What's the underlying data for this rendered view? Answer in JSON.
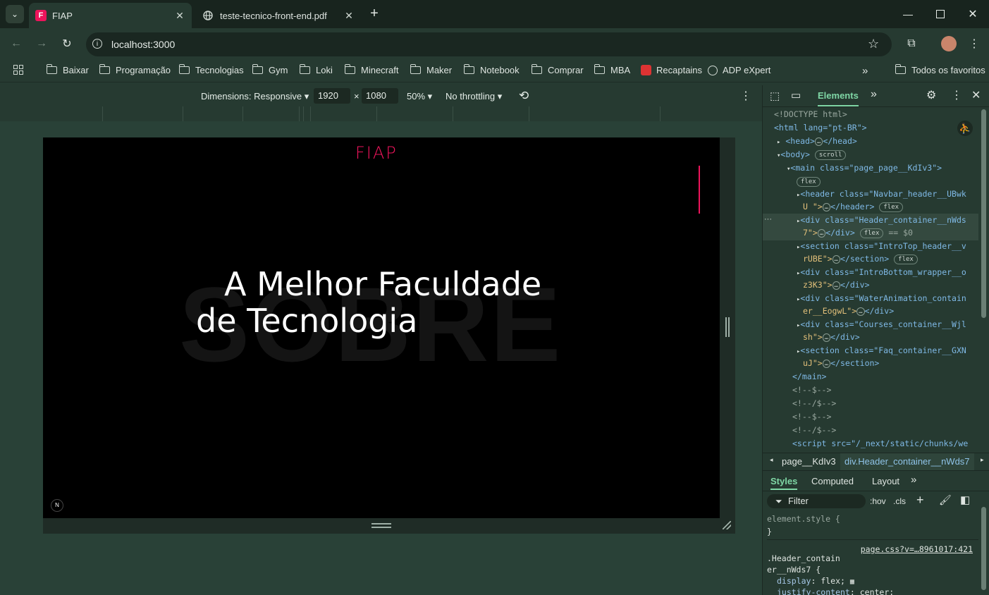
{
  "tabs": [
    {
      "title": "FIAP",
      "active": true
    },
    {
      "title": "teste-tecnico-front-end.pdf",
      "active": false
    }
  ],
  "omnibox": {
    "url": "localhost:3000"
  },
  "bookmarks": [
    "Baixar",
    "Programação",
    "Tecnologias",
    "Gym",
    "Loki",
    "Minecraft",
    "Maker",
    "Notebook",
    "Comprar",
    "MBA",
    "Recaptains",
    "ADP eXpert"
  ],
  "bookmarks_all": "Todos os favoritos",
  "device": {
    "dimensions": "Dimensions: Responsive",
    "width": "1920",
    "height": "1080",
    "times": "×",
    "zoom": "50%",
    "throttle": "No throttling"
  },
  "page": {
    "logo": "FIAP",
    "bg_word": "SOBRE",
    "line1": "A Melhor Faculdade",
    "line2": "de Tecnologia",
    "badge": "N",
    "accent": "#ed145b"
  },
  "devtools": {
    "elements_tab": "Elements",
    "dom": [
      {
        "t": "<!DOCTYPE html>",
        "cls": "cmt"
      },
      {
        "t": "<html lang=\"pt-BR\">"
      },
      {
        "t": "<head>"
      },
      {
        "t": "<body>"
      },
      {
        "t": "<main class=\"page_page__KdIv3\">"
      },
      {
        "t": "<header class=\"Navbar_header__UBwk"
      },
      {
        "t": "U \">"
      },
      {
        "t": "<div class=\"Header_container__nWds"
      },
      {
        "t": "7\">"
      },
      {
        "t": "<section class=\"IntroTop_header__v"
      },
      {
        "t": "rUBE\">"
      },
      {
        "t": "<div class=\"IntroBottom_wrapper__o"
      },
      {
        "t": "z3K3\">"
      },
      {
        "t": "<div class=\"WaterAnimation_contain"
      },
      {
        "t": "er__EogwL\">"
      },
      {
        "t": "<div class=\"Courses_container__Wjl"
      },
      {
        "t": "sh\">"
      },
      {
        "t": "<section class=\"Faq_container__GXN"
      },
      {
        "t": "uJ\">"
      },
      {
        "t": "</main>"
      },
      {
        "t": "<!--$-->"
      },
      {
        "t": "<!--/$-->"
      },
      {
        "t": "<!--$-->"
      },
      {
        "t": "<!--/$-->"
      },
      {
        "t": "<script src=\"/_next/static/chunks/we"
      }
    ],
    "pills": {
      "scroll": "scroll",
      "flex": "flex",
      "sel": "== $0"
    },
    "closers": {
      "head": "</head>",
      "header": "</header>",
      "div": "</div>",
      "section": "</section>"
    },
    "breadcrumb": [
      "page__KdIv3",
      "div.Header_container__nWds7"
    ],
    "styles_tabs": [
      "Styles",
      "Computed",
      "Layout"
    ],
    "filter": "Filter",
    "hov": ":hov",
    "cls": ".cls",
    "rules": {
      "element_style": "element.style {",
      "close": "}",
      "source": "page.css?v=…8961017:421",
      "selector1": ".Header_contain",
      "selector2": "er__nWds7 {",
      "prop1": "display",
      "val1": "flex;",
      "prop2": "justify-content",
      "val2": "center;"
    }
  }
}
